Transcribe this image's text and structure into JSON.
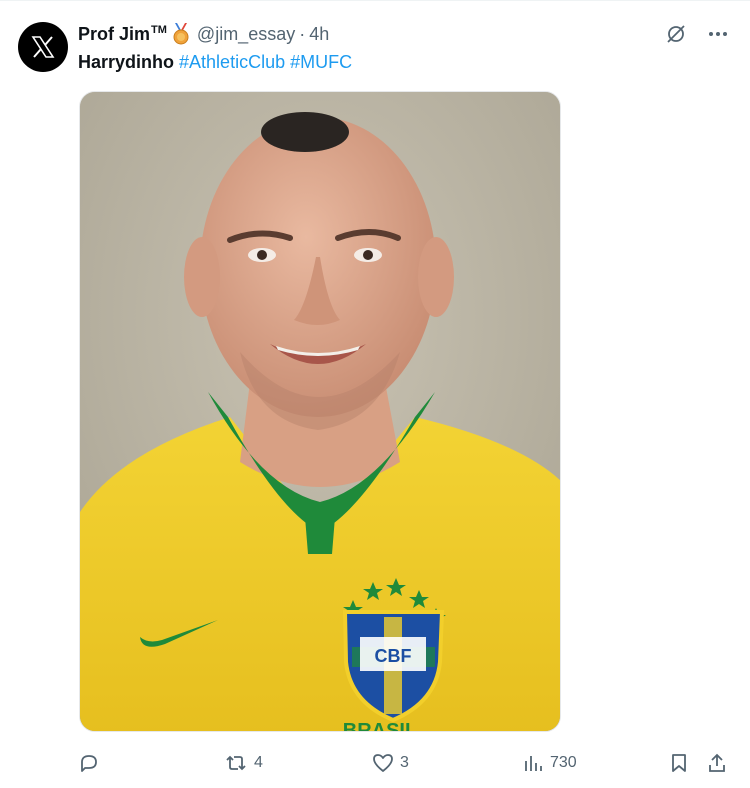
{
  "tweet": {
    "author": {
      "display_name": "Prof Jim",
      "tm": "TM",
      "handle": "@jim_essay",
      "separator": "·",
      "time": "4h"
    },
    "text": {
      "plain": "Harrydinho",
      "hashtags": [
        "#AthleticClub",
        "#MUFC"
      ]
    },
    "media": {
      "crest_text": "CBF",
      "shirt_text": "BRASIL",
      "colors": {
        "background": "#bfb9a8",
        "shirt": "#f2cf2b",
        "collar": "#1f8a3a",
        "crest_blue": "#1c4fa3"
      }
    },
    "actions": {
      "reply_count": "",
      "repost_count": "4",
      "like_count": "3",
      "views_count": "730"
    },
    "colors": {
      "text": "#0f1419",
      "secondary": "#536471",
      "link": "#1d9bf0"
    }
  }
}
